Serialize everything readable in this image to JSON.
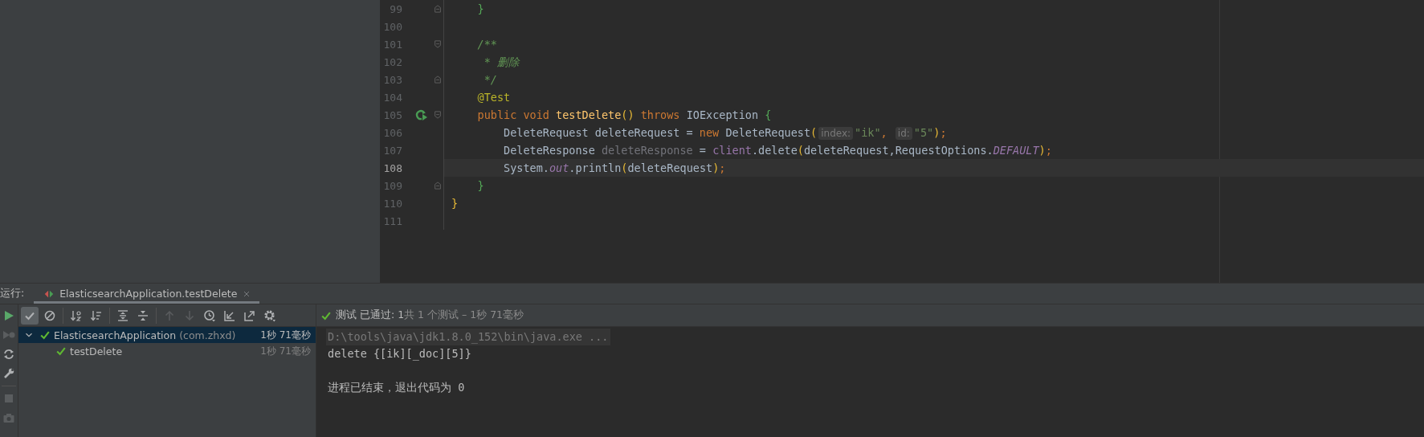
{
  "editor": {
    "lines": [
      {
        "number": "99",
        "current": false,
        "fold_start": false,
        "fold_end": true,
        "run_marker": false,
        "tokens": [
          {
            "kind": "brace_inner",
            "text": "    }"
          }
        ]
      },
      {
        "number": "100",
        "current": false,
        "fold_start": false,
        "fold_end": false,
        "run_marker": false
      },
      {
        "number": "101",
        "current": false,
        "fold_start": true,
        "fold_end": false,
        "run_marker": false,
        "tokens": [
          {
            "kind": "doc",
            "text": "    /**"
          }
        ]
      },
      {
        "number": "102",
        "current": false,
        "fold_start": false,
        "fold_end": false,
        "run_marker": false,
        "tokens": [
          {
            "kind": "doc",
            "text": "     * 删除"
          }
        ]
      },
      {
        "number": "103",
        "current": false,
        "fold_start": false,
        "fold_end": true,
        "run_marker": false,
        "tokens": [
          {
            "kind": "doc",
            "text": "     */"
          }
        ]
      },
      {
        "number": "104",
        "current": false,
        "fold_start": false,
        "fold_end": false,
        "run_marker": false,
        "tokens": [
          {
            "kind": "annotation",
            "text": "    @Test"
          }
        ]
      },
      {
        "number": "105",
        "current": false,
        "fold_start": true,
        "fold_end": false,
        "run_marker": true,
        "tokens": [
          {
            "kind": "keyword",
            "text": "    public void"
          },
          {
            "kind": "method",
            "text": " testDelete"
          },
          {
            "kind": "brace_outer",
            "text": "()"
          },
          {
            "kind": "keyword",
            "text": " throws"
          },
          {
            "kind": "plain",
            "text": " IOException"
          },
          {
            "kind": "brace_inner",
            "text": " {"
          }
        ]
      },
      {
        "number": "106",
        "current": false,
        "fold_start": false,
        "fold_end": false,
        "run_marker": false,
        "tokens": [
          {
            "kind": "plain",
            "text": "        DeleteRequest deleteRequest = "
          },
          {
            "kind": "keyword",
            "text": "new"
          },
          {
            "kind": "plain",
            "text": " DeleteRequest"
          },
          {
            "kind": "brace_outer",
            "text": "("
          },
          {
            "kind": "hint",
            "text": "index:"
          },
          {
            "kind": "string",
            "text": "\"ik\""
          },
          {
            "kind": "punct",
            "text": ", "
          },
          {
            "kind": "hint",
            "text": "id:"
          },
          {
            "kind": "string",
            "text": "\"5\""
          },
          {
            "kind": "brace_outer",
            "text": ")"
          },
          {
            "kind": "punct",
            "text": ";"
          }
        ]
      },
      {
        "number": "107",
        "current": false,
        "fold_start": false,
        "fold_end": false,
        "run_marker": false,
        "tokens": [
          {
            "kind": "plain",
            "text": "        DeleteResponse "
          },
          {
            "kind": "unused",
            "text": "deleteResponse"
          },
          {
            "kind": "plain",
            "text": " = "
          },
          {
            "kind": "field",
            "text": "client"
          },
          {
            "kind": "plain",
            "text": ".delete"
          },
          {
            "kind": "brace_outer",
            "text": "("
          },
          {
            "kind": "plain",
            "text": "deleteRequest,RequestOptions."
          },
          {
            "kind": "static",
            "text": "DEFAULT"
          },
          {
            "kind": "brace_outer",
            "text": ")"
          },
          {
            "kind": "punct",
            "text": ";"
          }
        ]
      },
      {
        "number": "108",
        "current": true,
        "fold_start": false,
        "fold_end": false,
        "run_marker": false,
        "tokens": [
          {
            "kind": "plain",
            "text": "        System."
          },
          {
            "kind": "static",
            "text": "out"
          },
          {
            "kind": "plain",
            "text": ".println"
          },
          {
            "kind": "brace_outer",
            "text": "("
          },
          {
            "kind": "plain",
            "text": "deleteRequest"
          },
          {
            "kind": "brace_outer",
            "text": ")"
          },
          {
            "kind": "punct",
            "text": ";"
          }
        ]
      },
      {
        "number": "109",
        "current": false,
        "fold_start": false,
        "fold_end": true,
        "run_marker": false,
        "tokens": [
          {
            "kind": "brace_inner",
            "text": "    }"
          }
        ]
      },
      {
        "number": "110",
        "current": false,
        "fold_start": false,
        "fold_end": false,
        "run_marker": false,
        "tokens": [
          {
            "kind": "brace_outer",
            "text": "}"
          }
        ]
      },
      {
        "number": "111",
        "current": false,
        "fold_start": false,
        "fold_end": false,
        "run_marker": false
      }
    ]
  },
  "run_panel": {
    "label": "运行:",
    "tabs": [
      {
        "title": "ElasticsearchApplication.testDelete",
        "selected": true
      }
    ],
    "side_tools": [
      {
        "kind": "run",
        "disabled": false
      },
      {
        "kind": "rerun-failed",
        "disabled": true
      },
      {
        "kind": "auto-test",
        "disabled": false
      },
      {
        "kind": "wrench",
        "disabled": false
      },
      {
        "kind": "stop",
        "disabled": true
      },
      {
        "kind": "camera",
        "disabled": true
      }
    ],
    "toolbar": [
      [
        {
          "kind": "check",
          "selected": true,
          "disabled": false
        },
        {
          "kind": "ignored",
          "selected": false,
          "disabled": false
        }
      ],
      [
        {
          "kind": "sort-alpha",
          "selected": false,
          "disabled": false
        },
        {
          "kind": "sort-duration",
          "selected": false,
          "disabled": false
        }
      ],
      [
        {
          "kind": "expand-all",
          "selected": false,
          "disabled": false
        },
        {
          "kind": "collapse-all",
          "selected": false,
          "disabled": false
        }
      ],
      [
        {
          "kind": "up",
          "selected": false,
          "disabled": true
        },
        {
          "kind": "down",
          "selected": false,
          "disabled": true
        },
        {
          "kind": "history",
          "selected": false,
          "disabled": false
        },
        {
          "kind": "import",
          "selected": false,
          "disabled": false
        },
        {
          "kind": "export",
          "selected": false,
          "disabled": false
        },
        {
          "kind": "gear",
          "selected": false,
          "disabled": false
        }
      ]
    ],
    "status": {
      "passed": "测试 已通过: 1",
      "detail": "共 1 个测试 – 1秒 71毫秒"
    },
    "tree": [
      {
        "name": "ElasticsearchApplication",
        "package": "(com.zhxd)",
        "time": "1秒 71毫秒",
        "expanded": true,
        "selected": true,
        "children": [
          {
            "name": "testDelete",
            "time": "1秒 71毫秒",
            "selected": false
          }
        ]
      }
    ],
    "console": [
      {
        "kind": "command",
        "text": "D:\\tools\\java\\jdk1.8.0_152\\bin\\java.exe ..."
      },
      {
        "kind": "output",
        "text": "delete {[ik][_doc][5]}"
      },
      {
        "kind": "exit",
        "text": "进程已结束，退出代码为 0"
      }
    ]
  }
}
